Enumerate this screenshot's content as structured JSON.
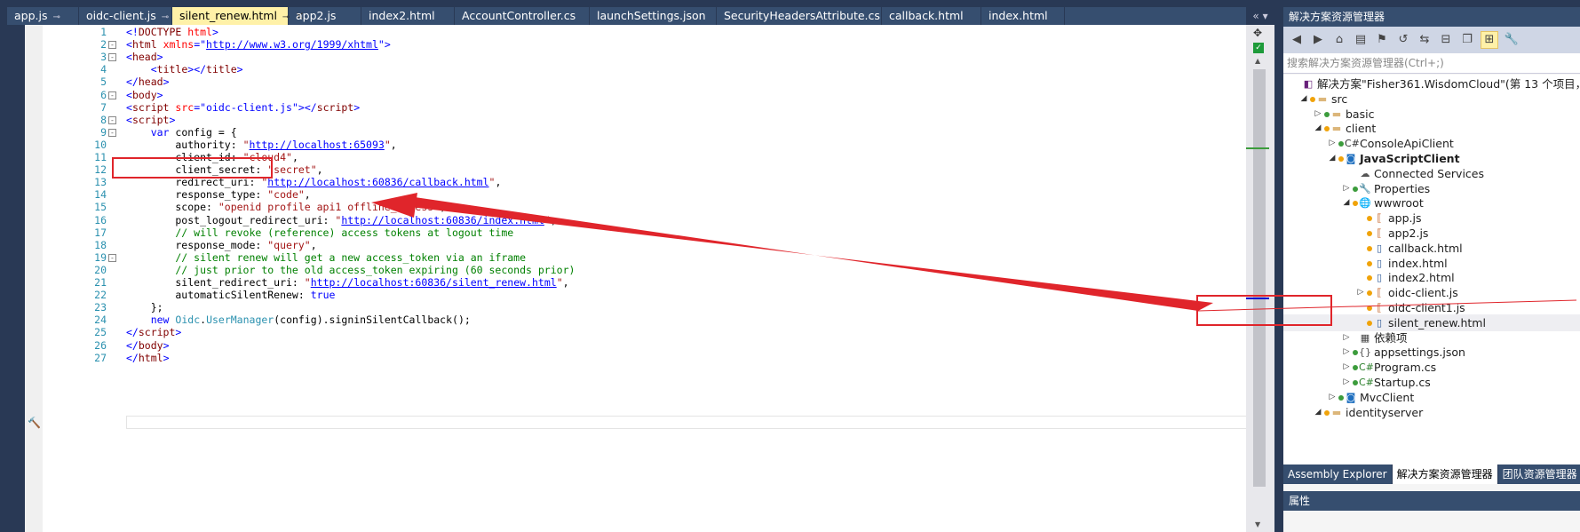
{
  "tabs": [
    {
      "label": "app.js",
      "pinned": true
    },
    {
      "label": "oidc-client.js",
      "pinned": true
    },
    {
      "label": "silent_renew.html",
      "pinned": true,
      "active": true,
      "closable": true
    },
    {
      "label": "app2.js"
    },
    {
      "label": "index2.html"
    },
    {
      "label": "AccountController.cs"
    },
    {
      "label": "launchSettings.json"
    },
    {
      "label": "SecurityHeadersAttribute.cs"
    },
    {
      "label": "callback.html"
    },
    {
      "label": "index.html"
    }
  ],
  "tab_nav": "«  ▾",
  "code_lines": [
    {
      "n": "1",
      "fold": "",
      "segs": [
        [
          "punc",
          "<!"
        ],
        [
          "tag",
          "DOCTYPE"
        ],
        [
          "attr",
          " html"
        ],
        [
          "punc",
          ">"
        ]
      ]
    },
    {
      "n": "2",
      "fold": "-",
      "segs": [
        [
          "punc",
          "<"
        ],
        [
          "tag",
          "html"
        ],
        [
          "attr",
          " xmlns"
        ],
        [
          "punc",
          "=\""
        ],
        [
          "url",
          "http://www.w3.org/1999/xhtml"
        ],
        [
          "punc",
          "\">"
        ]
      ]
    },
    {
      "n": "3",
      "fold": "-",
      "segs": [
        [
          "punc",
          "<"
        ],
        [
          "tag",
          "head"
        ],
        [
          "punc",
          ">"
        ]
      ]
    },
    {
      "n": "4",
      "fold": "",
      "segs": [
        [
          "plain",
          "    "
        ],
        [
          "punc",
          "<"
        ],
        [
          "tag",
          "title"
        ],
        [
          "punc",
          "></"
        ],
        [
          "tag",
          "title"
        ],
        [
          "punc",
          ">"
        ]
      ]
    },
    {
      "n": "5",
      "fold": "",
      "segs": [
        [
          "punc",
          "</"
        ],
        [
          "tag",
          "head"
        ],
        [
          "punc",
          ">"
        ]
      ]
    },
    {
      "n": "6",
      "fold": "-",
      "segs": [
        [
          "punc",
          "<"
        ],
        [
          "tag",
          "body"
        ],
        [
          "punc",
          ">"
        ]
      ]
    },
    {
      "n": "7",
      "fold": "",
      "segs": [
        [
          "punc",
          "<"
        ],
        [
          "tag",
          "script"
        ],
        [
          "attr",
          " src"
        ],
        [
          "punc",
          "=\""
        ],
        [
          "val",
          "oidc-client.js"
        ],
        [
          "punc",
          "\"></"
        ],
        [
          "tag",
          "script"
        ],
        [
          "punc",
          ">"
        ]
      ]
    },
    {
      "n": "8",
      "fold": "-",
      "segs": [
        [
          "punc",
          "<"
        ],
        [
          "tag",
          "script"
        ],
        [
          "punc",
          ">"
        ]
      ]
    },
    {
      "n": "9",
      "fold": "-",
      "segs": [
        [
          "plain",
          "    "
        ],
        [
          "kw",
          "var"
        ],
        [
          "plain",
          " config = {"
        ]
      ]
    },
    {
      "n": "10",
      "fold": "",
      "segs": [
        [
          "plain",
          "        authority: "
        ],
        [
          "str",
          "\""
        ],
        [
          "url",
          "http://localhost:65093"
        ],
        [
          "str",
          "\""
        ],
        [
          "plain",
          ","
        ]
      ]
    },
    {
      "n": "11",
      "fold": "",
      "segs": [
        [
          "plain",
          "        client_id: "
        ],
        [
          "str",
          "\"cloud4\""
        ],
        [
          "plain",
          ","
        ]
      ]
    },
    {
      "n": "12",
      "fold": "",
      "segs": [
        [
          "plain",
          "        client_secret: "
        ],
        [
          "str",
          "\"secret\""
        ],
        [
          "plain",
          ","
        ]
      ]
    },
    {
      "n": "13",
      "fold": "",
      "segs": [
        [
          "plain",
          "        redirect_uri: "
        ],
        [
          "str",
          "\""
        ],
        [
          "url",
          "http://localhost:60836/callback.html"
        ],
        [
          "str",
          "\""
        ],
        [
          "plain",
          ","
        ]
      ]
    },
    {
      "n": "14",
      "fold": "",
      "segs": [
        [
          "plain",
          "        response_type: "
        ],
        [
          "str",
          "\"code\""
        ],
        [
          "plain",
          ","
        ]
      ]
    },
    {
      "n": "15",
      "fold": "",
      "segs": [
        [
          "plain",
          "        scope: "
        ],
        [
          "str",
          "\"openid profile api1 offline_access\""
        ],
        [
          "plain",
          ","
        ]
      ]
    },
    {
      "n": "16",
      "fold": "",
      "segs": [
        [
          "plain",
          "        post_logout_redirect_uri: "
        ],
        [
          "str",
          "\""
        ],
        [
          "url",
          "http://localhost:60836/index.html"
        ],
        [
          "str",
          "\""
        ],
        [
          "plain",
          ","
        ]
      ]
    },
    {
      "n": "17",
      "fold": "",
      "segs": [
        [
          "cm",
          "        // will revoke (reference) access tokens at logout time"
        ]
      ]
    },
    {
      "n": "18",
      "fold": "",
      "segs": [
        [
          "plain",
          "        response_mode: "
        ],
        [
          "str",
          "\"query\""
        ],
        [
          "plain",
          ","
        ]
      ]
    },
    {
      "n": "19",
      "fold": "-",
      "segs": [
        [
          "cm",
          "        // silent renew will get a new access_token via an iframe"
        ]
      ]
    },
    {
      "n": "20",
      "fold": "",
      "segs": [
        [
          "cm",
          "        // just prior to the old access_token expiring (60 seconds prior)"
        ]
      ]
    },
    {
      "n": "21",
      "fold": "",
      "segs": [
        [
          "plain",
          "        silent_redirect_uri: "
        ],
        [
          "str",
          "\""
        ],
        [
          "url",
          "http://localhost:60836/silent_renew.html"
        ],
        [
          "str",
          "\""
        ],
        [
          "plain",
          ","
        ]
      ]
    },
    {
      "n": "22",
      "fold": "",
      "segs": [
        [
          "plain",
          "        automaticSilentRenew: "
        ],
        [
          "kw",
          "true"
        ]
      ]
    },
    {
      "n": "23",
      "fold": "",
      "segs": [
        [
          "plain",
          "    };"
        ]
      ]
    },
    {
      "n": "24",
      "fold": "",
      "segs": [
        [
          "plain",
          "    "
        ],
        [
          "kw",
          "new"
        ],
        [
          "plain",
          " "
        ],
        [
          "cls",
          "Oidc"
        ],
        [
          "plain",
          "."
        ],
        [
          "cls",
          "UserManager"
        ],
        [
          "plain",
          "(config).signinSilentCallback();"
        ]
      ]
    },
    {
      "n": "25",
      "fold": "",
      "segs": [
        [
          "punc",
          "</"
        ],
        [
          "tag",
          "script"
        ],
        [
          "punc",
          ">"
        ]
      ]
    },
    {
      "n": "26",
      "fold": "",
      "segs": [
        [
          "punc",
          "</"
        ],
        [
          "tag",
          "body"
        ],
        [
          "punc",
          ">"
        ]
      ]
    },
    {
      "n": "27",
      "fold": "",
      "segs": [
        [
          "punc",
          "</"
        ],
        [
          "tag",
          "html"
        ],
        [
          "punc",
          ">"
        ]
      ]
    }
  ],
  "explorer": {
    "title": "解决方案资源管理器",
    "search_placeholder": "搜索解决方案资源管理器(Ctrl+;)",
    "tree": [
      {
        "label": "解决方案\"Fisher361.WisdomCloud\"(第 13 个项目，共",
        "level": 0,
        "toggle": "",
        "icon": "sln",
        "dot": ""
      },
      {
        "label": "src",
        "level": 1,
        "toggle": "open",
        "icon": "folder",
        "dot": "orange"
      },
      {
        "label": "basic",
        "level": 2,
        "toggle": "closed",
        "icon": "folder",
        "dot": "green"
      },
      {
        "label": "client",
        "level": 2,
        "toggle": "open",
        "icon": "folder",
        "dot": "orange"
      },
      {
        "label": "ConsoleApiClient",
        "level": 3,
        "toggle": "closed",
        "icon": "cs",
        "dot": "green"
      },
      {
        "label": "JavaScriptClient",
        "level": 3,
        "toggle": "open",
        "icon": "web",
        "dot": "orange",
        "bold": true
      },
      {
        "label": "Connected Services",
        "level": 4,
        "toggle": "",
        "icon": "svc",
        "dot": ""
      },
      {
        "label": "Properties",
        "level": 4,
        "toggle": "closed",
        "icon": "wrench",
        "dot": "green"
      },
      {
        "label": "wwwroot",
        "level": 4,
        "toggle": "open",
        "icon": "globe",
        "dot": "orange"
      },
      {
        "label": "app.js",
        "level": 5,
        "toggle": "",
        "icon": "js",
        "dot": "orange"
      },
      {
        "label": "app2.js",
        "level": 5,
        "toggle": "",
        "icon": "js",
        "dot": "orange"
      },
      {
        "label": "callback.html",
        "level": 5,
        "toggle": "",
        "icon": "html",
        "dot": "orange"
      },
      {
        "label": "index.html",
        "level": 5,
        "toggle": "",
        "icon": "html",
        "dot": "orange"
      },
      {
        "label": "index2.html",
        "level": 5,
        "toggle": "",
        "icon": "html",
        "dot": "orange"
      },
      {
        "label": "oidc-client.js",
        "level": 5,
        "toggle": "closed",
        "icon": "js",
        "dot": "orange"
      },
      {
        "label": "oidc-client1.js",
        "level": 5,
        "toggle": "",
        "icon": "js",
        "dot": "orange"
      },
      {
        "label": "silent_renew.html",
        "level": 5,
        "toggle": "",
        "icon": "html",
        "dot": "orange",
        "selected": true
      },
      {
        "label": "依赖项",
        "level": 4,
        "toggle": "closed",
        "icon": "dep",
        "dot": ""
      },
      {
        "label": "appsettings.json",
        "level": 4,
        "toggle": "closed",
        "icon": "json",
        "dot": "green"
      },
      {
        "label": "Program.cs",
        "level": 4,
        "toggle": "closed",
        "icon": "csf",
        "dot": "green"
      },
      {
        "label": "Startup.cs",
        "level": 4,
        "toggle": "closed",
        "icon": "csf",
        "dot": "green"
      },
      {
        "label": "MvcClient",
        "level": 3,
        "toggle": "closed",
        "icon": "web",
        "dot": "green"
      },
      {
        "label": "identityserver",
        "level": 2,
        "toggle": "open",
        "icon": "folder",
        "dot": "orange"
      }
    ],
    "bottom_tabs": [
      {
        "label": "Assembly Explorer"
      },
      {
        "label": "解决方案资源管理器",
        "active": true
      },
      {
        "label": "团队资源管理器"
      }
    ],
    "properties_title": "属性"
  },
  "colors": {
    "annotation_red": "#e0252b",
    "dot_orange": "#f0a30a",
    "dot_green": "#3c9c3c",
    "active_tab": "#fff1a8"
  }
}
